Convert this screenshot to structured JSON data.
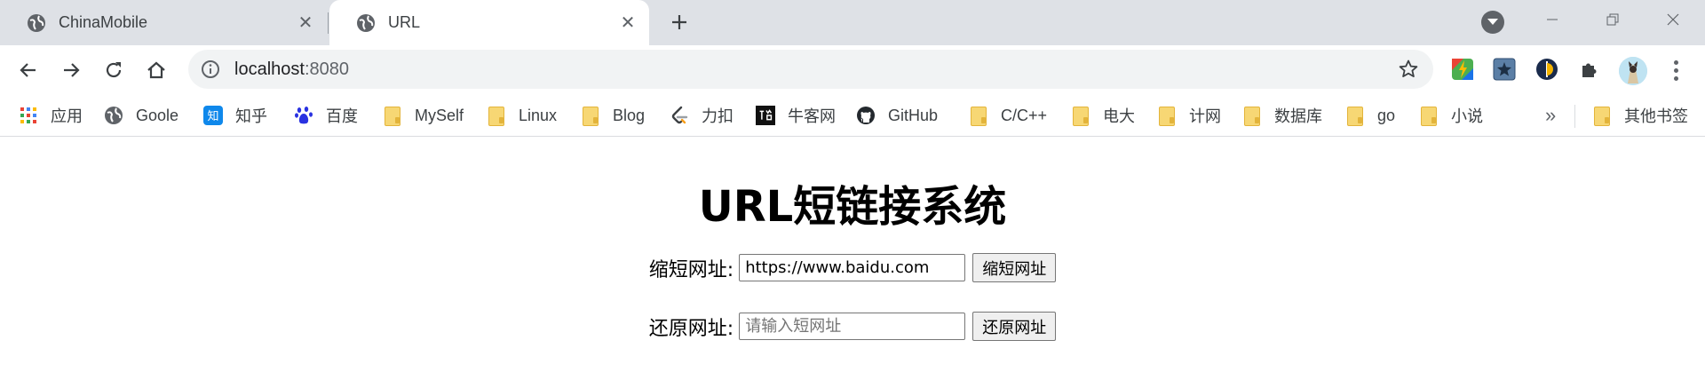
{
  "tabs": [
    {
      "title": "ChinaMobile",
      "icon": "globe-icon",
      "active": false
    },
    {
      "title": "URL",
      "icon": "globe-icon",
      "active": true
    }
  ],
  "omnibox": {
    "host": "localhost",
    "port": ":8080"
  },
  "bookmarks": [
    {
      "label": "应用",
      "icon": "apps-grid-icon"
    },
    {
      "label": "Goole",
      "icon": "globe-icon"
    },
    {
      "label": "知乎",
      "icon": "zhihu-icon"
    },
    {
      "label": "百度",
      "icon": "baidu-paw-icon"
    },
    {
      "label": "MySelf",
      "icon": "folder-icon"
    },
    {
      "label": "Linux",
      "icon": "folder-icon"
    },
    {
      "label": "Blog",
      "icon": "folder-icon"
    },
    {
      "label": "力扣",
      "icon": "leetcode-icon"
    },
    {
      "label": "牛客网",
      "icon": "nowcoder-icon"
    },
    {
      "label": "GitHub",
      "icon": "github-icon"
    },
    {
      "label": "C/C++",
      "icon": "folder-icon"
    },
    {
      "label": "电大",
      "icon": "folder-icon"
    },
    {
      "label": "计网",
      "icon": "folder-icon"
    },
    {
      "label": "数据库",
      "icon": "folder-icon"
    },
    {
      "label": "go",
      "icon": "folder-icon"
    },
    {
      "label": "小说",
      "icon": "folder-icon"
    }
  ],
  "bookmarks_more": "»",
  "other_bookmarks": {
    "label": "其他书签",
    "icon": "folder-icon"
  },
  "page": {
    "title": "URL短链接系统",
    "shorten": {
      "label": "缩短网址:",
      "value": "https://www.baidu.com",
      "button": "缩短网址"
    },
    "restore": {
      "label": "还原网址:",
      "placeholder": "请输入短网址",
      "button": "还原网址"
    }
  },
  "colors": {
    "tab_strip": "#dee1e6",
    "omnibox": "#f1f3f4",
    "folder": "#f7d774",
    "zhihu": "#0f88eb",
    "baidu": "#2932e1"
  }
}
